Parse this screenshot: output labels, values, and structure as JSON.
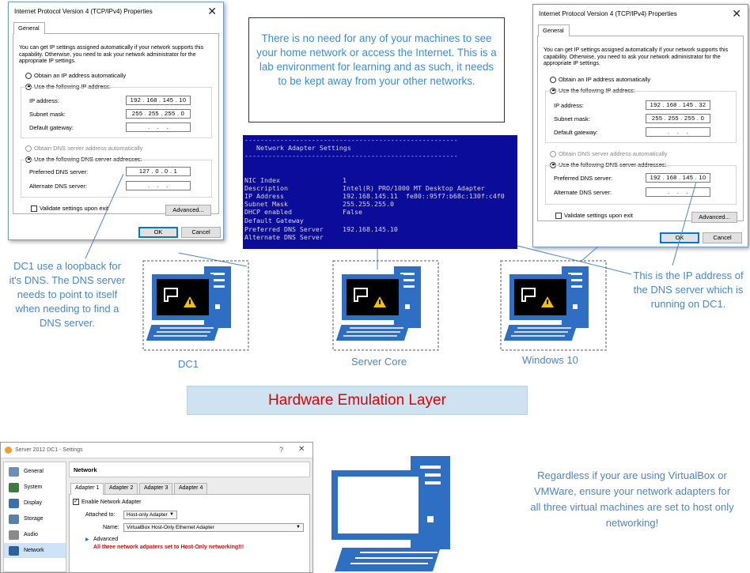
{
  "dialog_left": {
    "title": "Internet Protocol Version 4 (TCP/IPv4) Properties",
    "close": "✕",
    "tab": "General",
    "paragraph": "You can get IP settings assigned automatically if your network supports this capability. Otherwise, you need to ask your network administrator for the appropriate IP settings.",
    "radio_auto_ip": "Obtain an IP address automatically",
    "radio_use_ip": "Use the following IP address:",
    "ip_label": "IP address:",
    "ip_value": "192 . 168 . 145 . 10",
    "mask_label": "Subnet mask:",
    "mask_value": "255 . 255 . 255 . 0",
    "gateway_label": "Default gateway:",
    "gateway_value": "  .    .    .  ",
    "radio_auto_dns": "Obtain DNS server address automatically",
    "radio_use_dns": "Use the following DNS server addresses:",
    "pref_dns_label": "Preferred DNS server:",
    "pref_dns_value": "127 . 0 . 0 . 1",
    "alt_dns_label": "Alternate DNS server:",
    "alt_dns_value": "  .    .    .  ",
    "validate": "Validate settings upon exit",
    "advanced": "Advanced...",
    "ok": "OK",
    "cancel": "Cancel"
  },
  "dialog_right": {
    "title": "Internet Protocol Version 4 (TCP/IPv4) Properties",
    "close": "✕",
    "tab": "General",
    "paragraph": "You can get IP settings assigned automatically if your network supports this capability. Otherwise, you need to ask your network administrator for the appropriate IP settings.",
    "radio_auto_ip": "Obtain an IP address automatically",
    "radio_use_ip": "Use the following IP address:",
    "ip_label": "IP address:",
    "ip_value": "192 . 168 . 145 . 32",
    "mask_label": "Subnet mask:",
    "mask_value": "255 . 255 . 255 . 0",
    "gateway_label": "Default gateway:",
    "gateway_value": "  .    .    .  ",
    "radio_auto_dns": "Obtain DNS server address automatically",
    "radio_use_dns": "Use the following DNS server addresses:",
    "pref_dns_label": "Preferred DNS server:",
    "pref_dns_value": "192 . 168 . 145 . 10",
    "alt_dns_label": "Alternate DNS server:",
    "alt_dns_value": "  .    .    .  ",
    "validate": "Validate settings upon exit",
    "advanced": "Advanced...",
    "ok": "OK",
    "cancel": "Cancel"
  },
  "intro_text": "There is no need for any of your machines to see your home network or access the Internet. This is a lab environment for learning and as such, it needs to be kept away from your other networks.",
  "console": {
    "rule": "------------------------------------------------------",
    "heading": "   Network Adapter Settings",
    "rows": [
      {
        "label": "NIC Index",
        "value": "1"
      },
      {
        "label": "Description",
        "value": "Intel(R) PRO/1000 MT Desktop Adapter"
      },
      {
        "label": "IP Address",
        "value": "192.168.145.11  fe80::95f7:b68c:130f:c4f0"
      },
      {
        "label": "Subnet Mask",
        "value": "255.255.255.0"
      },
      {
        "label": "DHCP enabled",
        "value": "False"
      },
      {
        "label": "Default Gateway",
        "value": ""
      },
      {
        "label": "Preferred DNS Server",
        "value": "192.168.145.10"
      },
      {
        "label": "Alternate DNS Server",
        "value": ""
      }
    ]
  },
  "callout_dc1": "DC1 use a loopback for it's DNS. The DNS server needs to point to itself when needing to find a DNS server.",
  "callout_dns": "This is the IP address of the DNS server which is running on DC1.",
  "callout_bottom": "Regardless if your are using VirtualBox or VMWare, ensure your network adapters for all three virtual machines are set to host only networking!",
  "machines": {
    "dc1": "DC1",
    "server_core": "Server Core",
    "windows10": "Windows 10"
  },
  "layer_label": "Hardware Emulation Layer",
  "vbox": {
    "title": "Server 2012 DC1 - Settings",
    "help": "?",
    "close": "✕",
    "sidebar": [
      "General",
      "System",
      "Display",
      "Storage",
      "Audio",
      "Network"
    ],
    "section": "Network",
    "tabs": [
      "Adapter 1",
      "Adapter 2",
      "Adapter 3",
      "Adapter 4"
    ],
    "enable_label": "Enable Network Adapter",
    "attached_label": "Attached to:",
    "attached_value": "Host-only Adapter",
    "name_label": "Name:",
    "name_value": "VirtualBox Host-Only Ethernet Adapter",
    "advanced": "Advanced",
    "warning": "All three network adpaters set to Host-Only  networking!!!"
  },
  "colors": {
    "callout": "#4a86c5",
    "layer_bg": "#cfe2ef",
    "layer_text": "#e00000",
    "console_bg": "#0b0c9a",
    "monitor_blue": "#2e6fc4"
  }
}
